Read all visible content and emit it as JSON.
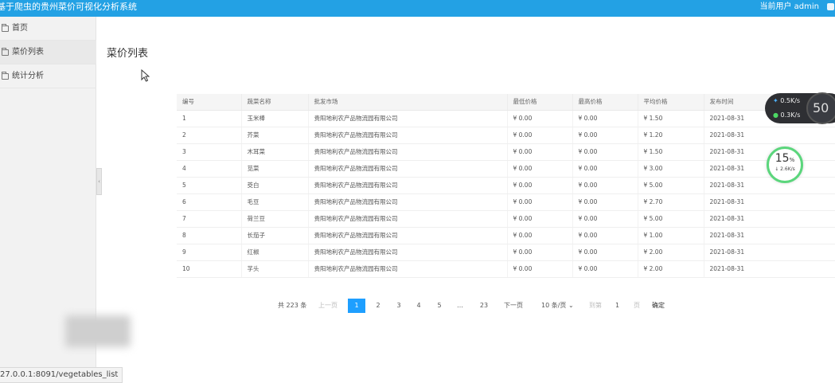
{
  "header": {
    "title": "基于爬虫的贵州菜价可视化分析系统",
    "user": "当前用户 admin"
  },
  "sidebar": {
    "items": [
      {
        "label": "首页",
        "icon": "folder-icon"
      },
      {
        "label": "菜价列表",
        "icon": "folder-icon"
      },
      {
        "label": "统计分析",
        "icon": "folder-icon"
      }
    ]
  },
  "main": {
    "title": "菜价列表"
  },
  "table": {
    "headers": [
      "编号",
      "蔬菜名称",
      "批发市场",
      "最低价格",
      "最高价格",
      "平均价格",
      "发布时间"
    ],
    "rows": [
      [
        "1",
        "玉米棒",
        "贵阳地利农产品物流园有限公司",
        "¥ 0.00",
        "¥ 0.00",
        "¥ 1.50",
        "2021-08-31"
      ],
      [
        "2",
        "芥菜",
        "贵阳地利农产品物流园有限公司",
        "¥ 0.00",
        "¥ 0.00",
        "¥ 1.20",
        "2021-08-31"
      ],
      [
        "3",
        "木耳菜",
        "贵阳地利农产品物流园有限公司",
        "¥ 0.00",
        "¥ 0.00",
        "¥ 1.50",
        "2021-08-31"
      ],
      [
        "4",
        "苋菜",
        "贵阳地利农产品物流园有限公司",
        "¥ 0.00",
        "¥ 0.00",
        "¥ 3.00",
        "2021-08-31"
      ],
      [
        "5",
        "茭白",
        "贵阳地利农产品物流园有限公司",
        "¥ 0.00",
        "¥ 0.00",
        "¥ 5.00",
        "2021-08-31"
      ],
      [
        "6",
        "毛豆",
        "贵阳地利农产品物流园有限公司",
        "¥ 0.00",
        "¥ 0.00",
        "¥ 2.70",
        "2021-08-31"
      ],
      [
        "7",
        "荷兰豆",
        "贵阳地利农产品物流园有限公司",
        "¥ 0.00",
        "¥ 0.00",
        "¥ 5.00",
        "2021-08-31"
      ],
      [
        "8",
        "长茄子",
        "贵阳地利农产品物流园有限公司",
        "¥ 0.00",
        "¥ 0.00",
        "¥ 1.00",
        "2021-08-31"
      ],
      [
        "9",
        "红椒",
        "贵阳地利农产品物流园有限公司",
        "¥ 0.00",
        "¥ 0.00",
        "¥ 2.00",
        "2021-08-31"
      ],
      [
        "10",
        "芋头",
        "贵阳地利农产品物流园有限公司",
        "¥ 0.00",
        "¥ 0.00",
        "¥ 2.00",
        "2021-08-31"
      ]
    ]
  },
  "pagination": {
    "total": "共 223 条",
    "prev": "上一页",
    "pages": [
      "1",
      "2",
      "3",
      "4",
      "5"
    ],
    "ellipsis": "…",
    "last_page": "23",
    "next": "下一页",
    "page_size": "10 条/页",
    "goto_label": "到第",
    "goto_value": "1",
    "page_unit": "页",
    "confirm": "确定"
  },
  "speed_widget": {
    "upload": "0.5K/s",
    "download": "0.3K/s",
    "load": "50"
  },
  "circle_widget": {
    "percent": "15",
    "percent_unit": "%",
    "rate": "↓ 2.6K/s"
  },
  "status_bar": {
    "url": "27.0.0.1:8091/vegetables_list"
  }
}
